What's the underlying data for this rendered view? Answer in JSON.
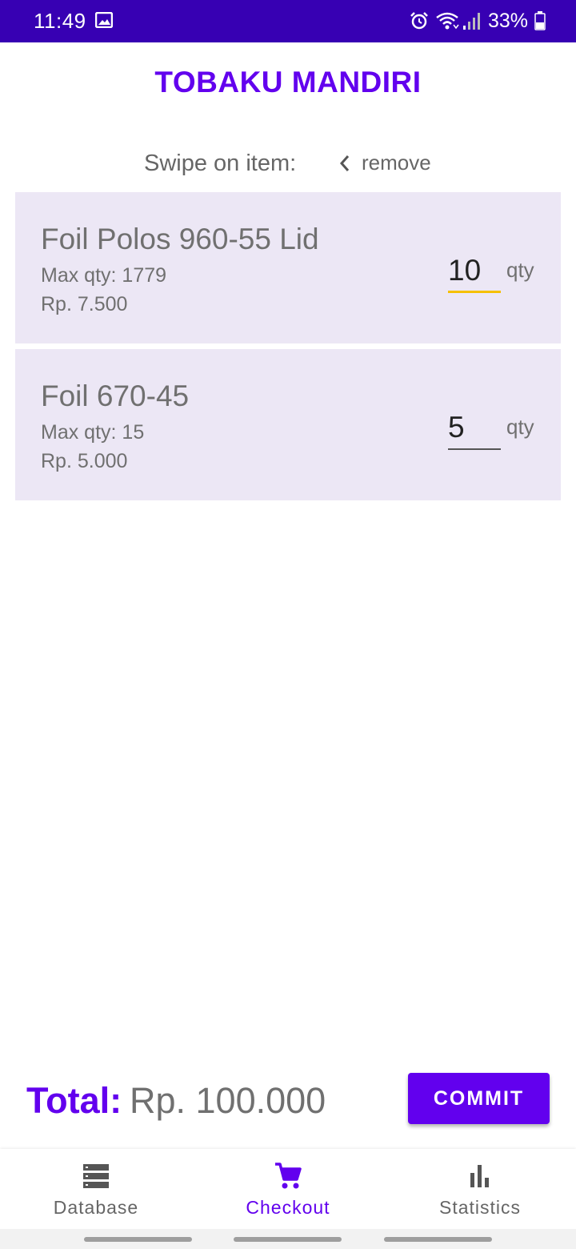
{
  "status_bar": {
    "time": "11:49",
    "battery": "33%",
    "icons": [
      "image-icon",
      "alarm-icon",
      "wifi-icon",
      "signal-icon",
      "battery-icon"
    ]
  },
  "app": {
    "title": "TOBAKU MANDIRI"
  },
  "swipe_hint": {
    "label": "Swipe on item:",
    "action": "remove"
  },
  "cart": {
    "items": [
      {
        "name": "Foil Polos 960-55 Lid",
        "max_qty": "Max qty: 1779",
        "price": "Rp. 7.500",
        "qty": "10",
        "qty_suffix": "qty"
      },
      {
        "name": "Foil 670-45",
        "max_qty": "Max qty: 15",
        "price": "Rp. 5.000",
        "qty": "5",
        "qty_suffix": "qty"
      }
    ]
  },
  "footer": {
    "total_label": "Total:",
    "total_value": "Rp. 100.000",
    "commit_label": "COMMIT"
  },
  "nav": {
    "active": "Checkout",
    "items": [
      {
        "label": "Database",
        "icon": "database-icon"
      },
      {
        "label": "Checkout",
        "icon": "cart-icon"
      },
      {
        "label": "Statistics",
        "icon": "bar-chart-icon"
      }
    ]
  },
  "colors": {
    "status_bar": "#3700b3",
    "primary": "#6200ee",
    "card_bg": "#ece7f5",
    "focus_underline": "#f5c000"
  }
}
